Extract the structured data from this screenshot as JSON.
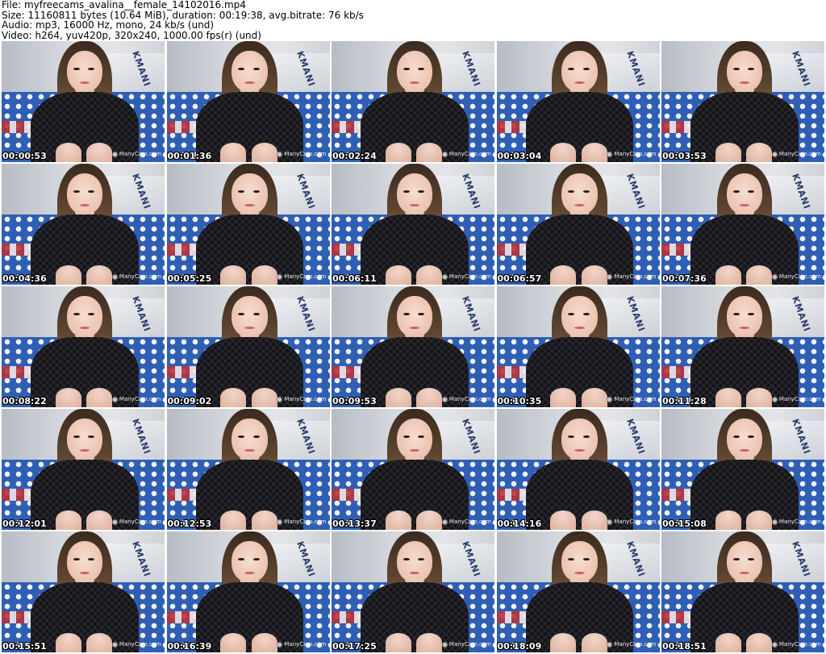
{
  "header": {
    "file_line": "File: myfreecams_avalina__female_14102016.mp4",
    "size_line": "Size: 11160811 bytes (10.64 MiB), duration: 00:19:38, avg.bitrate: 76 kb/s",
    "audio_line": "Audio: mp3, 16000 Hz, mono, 24 kb/s (und)",
    "video_line": "Video: h264, yuv420p, 320x240, 1000.00 fps(r) (und)"
  },
  "watermark_text": "ManyCam.com",
  "pillow_text": "KMANI",
  "thumbnails": [
    "00:00:53",
    "00:01:36",
    "00:02:24",
    "00:03:04",
    "00:03:53",
    "00:04:36",
    "00:05:25",
    "00:06:11",
    "00:06:57",
    "00:07:36",
    "00:08:22",
    "00:09:02",
    "00:09:53",
    "00:10:35",
    "00:11:28",
    "00:12:01",
    "00:12:53",
    "00:13:37",
    "00:14:16",
    "00:15:08",
    "00:15:51",
    "00:16:39",
    "00:17:25",
    "00:18:09",
    "00:18:51"
  ]
}
